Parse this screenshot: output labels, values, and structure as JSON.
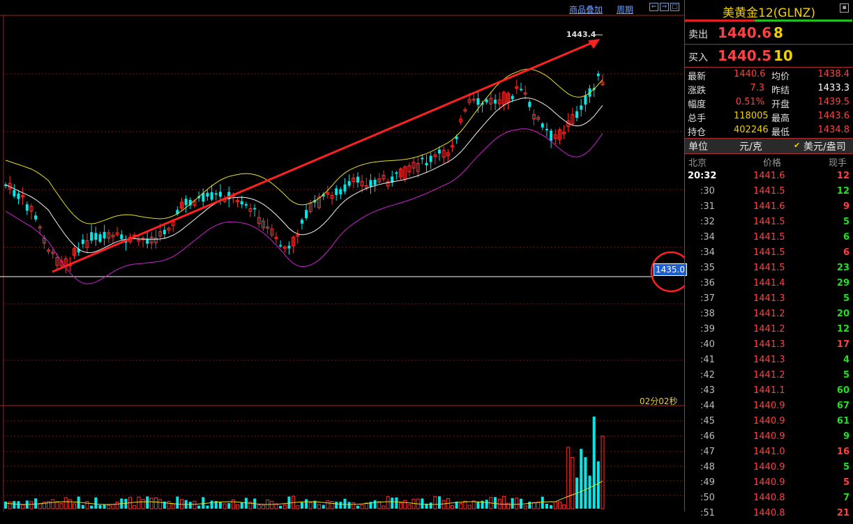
{
  "toolbar": {
    "overlay_label": "商品叠加",
    "period_label": "周期"
  },
  "chart": {
    "high_label": "1443.4",
    "price_tag": "1435.0",
    "timer": "02分02秒",
    "colors": {
      "up": "#ff3030",
      "down": "#00e8e8",
      "ma20": "#f5f5f5",
      "upper": "#e8e020",
      "lower": "#d020d0",
      "trend": "#ff2020",
      "grid": "#8a1010"
    }
  },
  "panel": {
    "title": "美黄金12(GLNZ)",
    "ask": {
      "label": "卖出",
      "price": "1440.6",
      "volume": "8"
    },
    "bid": {
      "label": "买入",
      "price": "1440.5",
      "volume": "10"
    },
    "stats": [
      {
        "l1": "最新",
        "v1": "1440.6",
        "l2": "均价",
        "v2": "1438.4"
      },
      {
        "l1": "涨跌",
        "v1": "7.3",
        "l2": "昨结",
        "v2": "1433.3"
      },
      {
        "l1": "幅度",
        "v1": "0.51%",
        "l2": "开盘",
        "v2": "1439.5"
      },
      {
        "l1": "总手",
        "v1": "118005",
        "l2": "最高",
        "v2": "1443.6"
      },
      {
        "l1": "持仓",
        "v1": "402246",
        "l2": "最低",
        "v2": "1434.8"
      }
    ],
    "unit": {
      "label": "单位",
      "value": "元/克",
      "check": "✔",
      "alt": "美元/盎司"
    },
    "tick_header": {
      "time": "北京",
      "price": "价格",
      "volume": "现手"
    },
    "ticks": [
      {
        "time": "20:32",
        "price": "1441.6",
        "vol": "12",
        "dir": "red"
      },
      {
        "time": ":30",
        "price": "1441.5",
        "vol": "12",
        "dir": "green"
      },
      {
        "time": ":31",
        "price": "1441.6",
        "vol": "9",
        "dir": "red"
      },
      {
        "time": ":32",
        "price": "1441.5",
        "vol": "5",
        "dir": "green"
      },
      {
        "time": ":34",
        "price": "1441.5",
        "vol": "6",
        "dir": "green"
      },
      {
        "time": ":34",
        "price": "1441.5",
        "vol": "6",
        "dir": "red"
      },
      {
        "time": ":35",
        "price": "1441.5",
        "vol": "23",
        "dir": "green"
      },
      {
        "time": ":36",
        "price": "1441.4",
        "vol": "29",
        "dir": "green"
      },
      {
        "time": ":37",
        "price": "1441.3",
        "vol": "5",
        "dir": "green"
      },
      {
        "time": ":38",
        "price": "1441.2",
        "vol": "20",
        "dir": "green"
      },
      {
        "time": ":39",
        "price": "1441.2",
        "vol": "12",
        "dir": "green"
      },
      {
        "time": ":40",
        "price": "1441.3",
        "vol": "17",
        "dir": "red"
      },
      {
        "time": ":41",
        "price": "1441.3",
        "vol": "4",
        "dir": "green"
      },
      {
        "time": ":42",
        "price": "1441.2",
        "vol": "5",
        "dir": "green"
      },
      {
        "time": ":43",
        "price": "1441.1",
        "vol": "60",
        "dir": "green"
      },
      {
        "time": ":44",
        "price": "1440.9",
        "vol": "67",
        "dir": "green"
      },
      {
        "time": ":45",
        "price": "1440.9",
        "vol": "61",
        "dir": "green"
      },
      {
        "time": ":46",
        "price": "1440.9",
        "vol": "9",
        "dir": "green"
      },
      {
        "time": ":47",
        "price": "1441.0",
        "vol": "16",
        "dir": "red"
      },
      {
        "time": ":48",
        "price": "1440.9",
        "vol": "5",
        "dir": "green"
      },
      {
        "time": ":49",
        "price": "1440.9",
        "vol": "5",
        "dir": "red"
      },
      {
        "time": ":50",
        "price": "1440.8",
        "vol": "7",
        "dir": "green"
      },
      {
        "time": ":51",
        "price": "1440.8",
        "vol": "21",
        "dir": "red"
      }
    ]
  }
}
